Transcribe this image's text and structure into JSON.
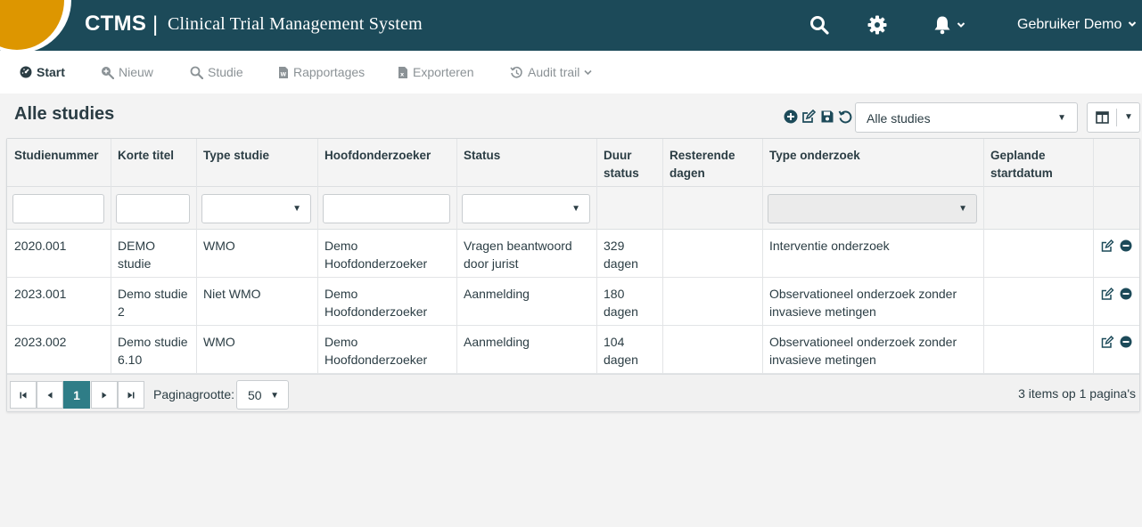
{
  "header": {
    "brand": "CTMS",
    "separator": "|",
    "subtitle": "Clinical Trial Management System",
    "user": "Gebruiker Demo",
    "icons": [
      "search-icon",
      "gear-icon",
      "bell-icon"
    ],
    "colors": {
      "bar": "#1c4a59",
      "logo": "#dd9600",
      "accent": "#2f7d87"
    }
  },
  "nav": {
    "start": "Start",
    "nieuw": "Nieuw",
    "studie": "Studie",
    "rapportages": "Rapportages",
    "exporteren": "Exporteren",
    "audit": "Audit trail"
  },
  "page": {
    "title": "Alle studies",
    "view_select": "Alle studies"
  },
  "table": {
    "headers": {
      "studienummer": "Studienummer",
      "korte_titel": "Korte titel",
      "type_studie": "Type studie",
      "hoofdonderzoeker": "Hoofdonderzoeker",
      "status": "Status",
      "duur_status_1": "Duur",
      "duur_status_2": "status",
      "resterende_1": "Resterende",
      "resterende_2": "dagen",
      "type_onderzoek": "Type onderzoek",
      "geplande_1": "Geplande",
      "geplande_2": "startdatum"
    },
    "rows": [
      {
        "studienummer": "2020.001",
        "titel_1": "DEMO",
        "titel_2": "studie",
        "type_studie": "WMO",
        "hoofd_1": "Demo",
        "hoofd_2": "Hoofdonderzoeker",
        "status_1": "Vragen beantwoord",
        "status_2": "door jurist",
        "duur_1": "329",
        "duur_2": "dagen",
        "onderzoek_1": "Interventie onderzoek",
        "onderzoek_2": ""
      },
      {
        "studienummer": "2023.001",
        "titel_1": "Demo studie",
        "titel_2": "2",
        "type_studie": "Niet WMO",
        "hoofd_1": "Demo",
        "hoofd_2": "Hoofdonderzoeker",
        "status_1": "Aanmelding",
        "status_2": "",
        "duur_1": "180",
        "duur_2": "dagen",
        "onderzoek_1": "Observationeel onderzoek zonder",
        "onderzoek_2": "invasieve metingen"
      },
      {
        "studienummer": "2023.002",
        "titel_1": "Demo studie",
        "titel_2": "6.10",
        "type_studie": "WMO",
        "hoofd_1": "Demo",
        "hoofd_2": "Hoofdonderzoeker",
        "status_1": "Aanmelding",
        "status_2": "",
        "duur_1": "104",
        "duur_2": "dagen",
        "onderzoek_1": "Observationeel onderzoek zonder",
        "onderzoek_2": "invasieve metingen"
      }
    ]
  },
  "pager": {
    "current_page": "1",
    "page_size_label": "Paginagrootte:",
    "page_size": "50",
    "info": "3 items op 1 pagina's"
  }
}
